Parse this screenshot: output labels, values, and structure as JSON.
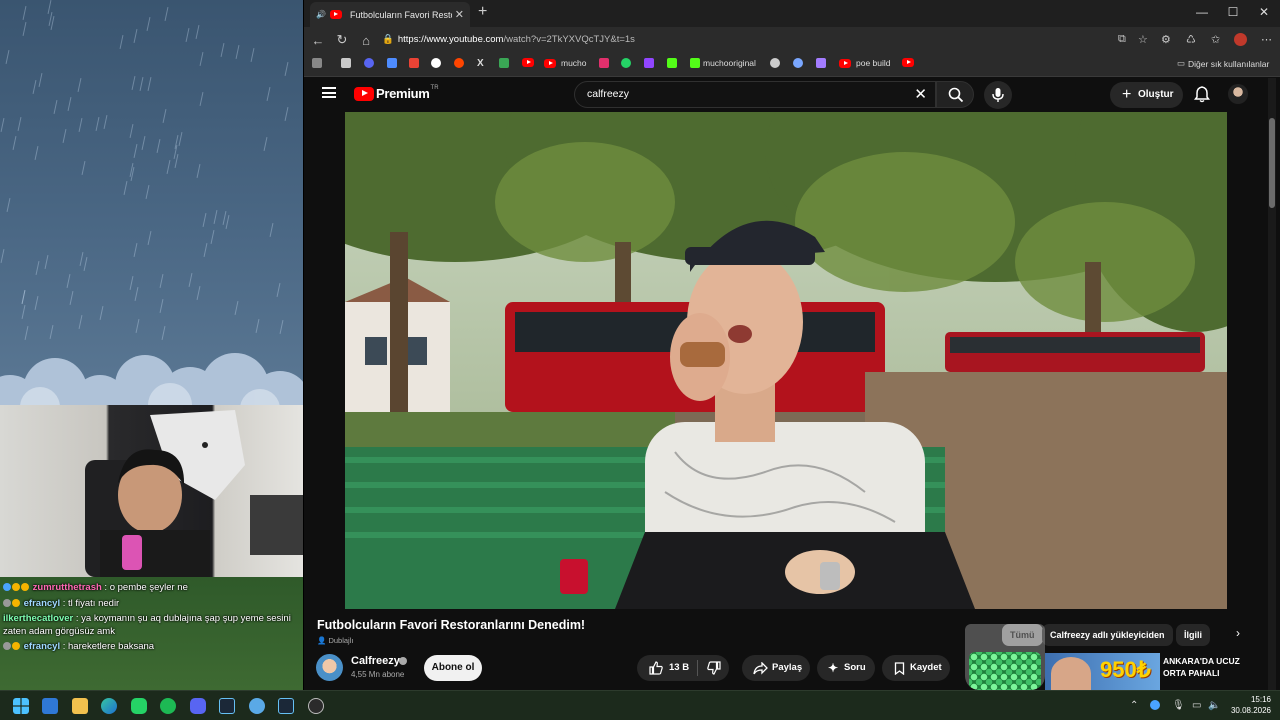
{
  "browser": {
    "tab_title": "Futbolcuların Favori Restoranl",
    "url_host": "https://www.youtube.com",
    "url_path": "/watch?v=2TkYXVQcTJY&t=1s",
    "bookmarks": [
      "mucho",
      "muchooriginal",
      "poe build"
    ],
    "other_bookmarks": "Diğer sık kullanılanlar"
  },
  "chat": [
    {
      "user": "zumrutthetrash",
      "message": "o pembe şeyler ne",
      "color": "#ff69b4"
    },
    {
      "user": "efrancyl",
      "message": "tl fiyatı nedir",
      "color": "#7ecbff"
    },
    {
      "user": "ilkerthecatlover",
      "message": "ya koymanın şu aq dublajına şap şup yeme sesini zaten adam görgüsüz amk",
      "color": "#7effb2"
    },
    {
      "user": "efrancyl",
      "message": "hareketlere baksana",
      "color": "#7ecbff"
    }
  ],
  "youtube": {
    "logo_text": "Premium",
    "region": "TR",
    "search_query": "calfreezy",
    "create_label": "Oluştur",
    "video_title": "Futbolcuların Favori Restoranlarını Denedim!",
    "dubbed_label": "Dublajlı",
    "channel_name": "Calfreezy",
    "subscribers": "4,55 Mn abone",
    "subscribe_label": "Abone ol",
    "like_count": "13 B",
    "share_label": "Paylaş",
    "ask_label": "Soru",
    "save_label": "Kaydet",
    "chips": {
      "all": "Tümü",
      "uploader": "Calfreezy adlı yükleyiciden",
      "related": "İlgili"
    },
    "ad_price": "950₺",
    "ad_text_line1": "ANKARA'DA UCUZ",
    "ad_text_line2": "ORTA PAHALI"
  },
  "taskbar": {
    "time": "15:16",
    "date": "30.08.2026"
  },
  "colors": {
    "youtube_red": "#ff0000",
    "dark_bg": "#0f0f0f"
  }
}
